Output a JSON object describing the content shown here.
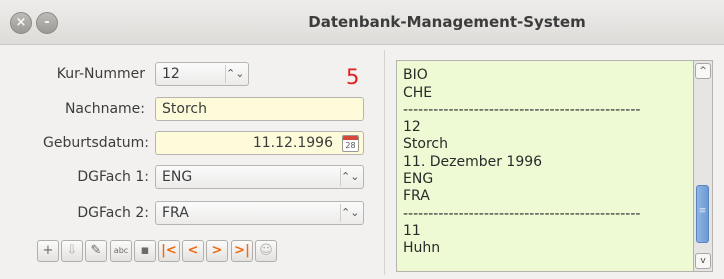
{
  "window": {
    "title": "Datenbank-Management-System",
    "close_glyph": "×",
    "minimize_glyph": "-"
  },
  "form": {
    "kurs_label": "Kur-Nummer",
    "kurs_value": "12",
    "counter": "5",
    "nachname_label": "Nachname:",
    "nachname_value": "Storch",
    "geburtsdatum_label": "Geburtsdatum:",
    "geburtsdatum_value": "11.12.1996",
    "dgfach1_label": "DGFach 1:",
    "dgfach1_value": "ENG",
    "dgfach2_label": "DGFach 2:",
    "dgfach2_value": "FRA"
  },
  "toolbar": [
    {
      "name": "new-record-icon",
      "glyph": "+",
      "enabled": true
    },
    {
      "name": "save-disabled-icon",
      "glyph": "⇩",
      "enabled": false
    },
    {
      "name": "edit-icon",
      "glyph": "✎",
      "enabled": true
    },
    {
      "name": "spellcheck-icon",
      "glyph": "abc",
      "enabled": true
    },
    {
      "name": "floppy-save-icon",
      "glyph": "▪",
      "enabled": true
    },
    {
      "name": "first-record-icon",
      "glyph": "|<",
      "enabled": true,
      "nav": true
    },
    {
      "name": "previous-record-icon",
      "glyph": "<",
      "enabled": true,
      "nav": true
    },
    {
      "name": "next-record-icon",
      "glyph": ">",
      "enabled": true,
      "nav": true
    },
    {
      "name": "last-record-icon",
      "glyph": ">|",
      "enabled": true,
      "nav": true
    },
    {
      "name": "user-icon",
      "glyph": "☺",
      "enabled": false
    }
  ],
  "textarea": {
    "lines": [
      "--------------------",
      "BIO",
      "CHE",
      "-----------------------------------------------",
      "12",
      "Storch",
      "11. Dezember 1996",
      "ENG",
      "FRA",
      "-----------------------------------------------",
      "11",
      "Huhn"
    ]
  },
  "scrollbar": {
    "up_glyph": "^",
    "down_glyph": "v",
    "grip": "≡"
  }
}
